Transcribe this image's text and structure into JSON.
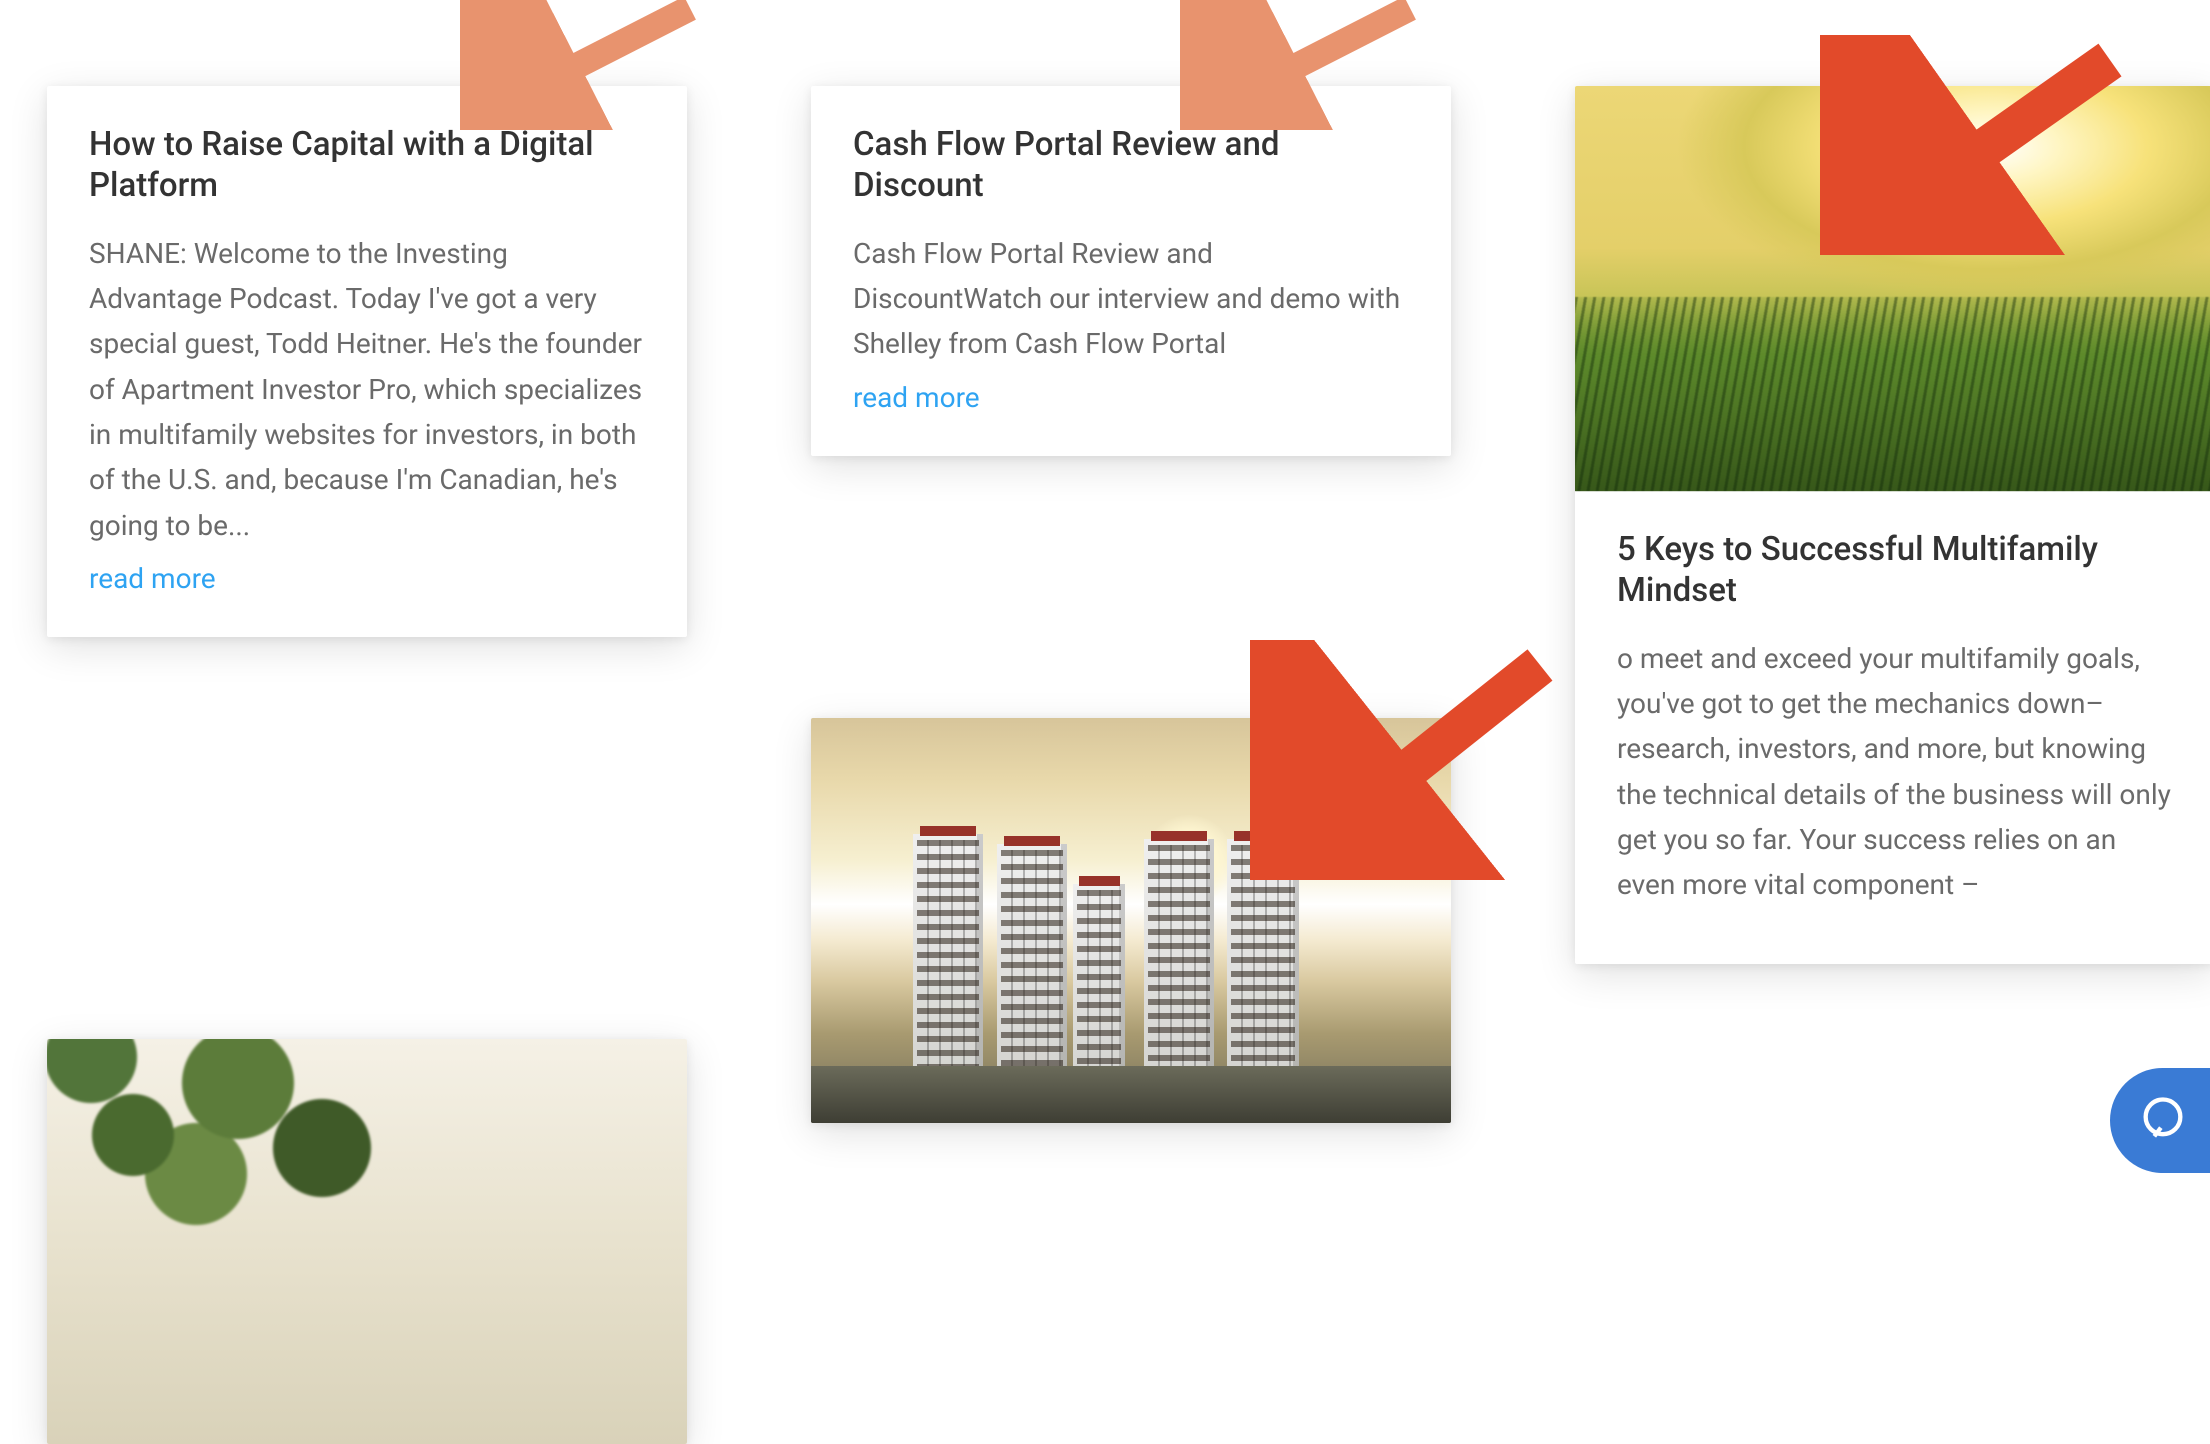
{
  "cards": [
    {
      "title": "How to Raise Capital with a Digital Platform",
      "excerpt": "SHANE: Welcome to the Investing Advantage Podcast. Today I've got a very special guest, Todd Heitner. He's the founder of Apartment Investor Pro, which specializes in multifamily websites for investors, in both of the U.S. and, because I'm Canadian, he's going to be...",
      "read_more": "read more"
    },
    {
      "title": "Cash Flow Portal Review and Discount",
      "excerpt": "Cash Flow Portal Review and DiscountWatch our interview and demo with Shelley from Cash Flow Portal",
      "read_more": "read more"
    },
    {
      "title": "5 Keys to Successful Multifamily Mindset",
      "excerpt": "o meet and exceed your multifamily goals, you've got to get the mechanics down– research, investors, and more, but knowing the technical details of the business will only get you so far.  Your success relies on an even more vital component –"
    }
  ],
  "annotation_arrows": {
    "color_small": "#e8936e",
    "color_large": "#e24a2a"
  }
}
